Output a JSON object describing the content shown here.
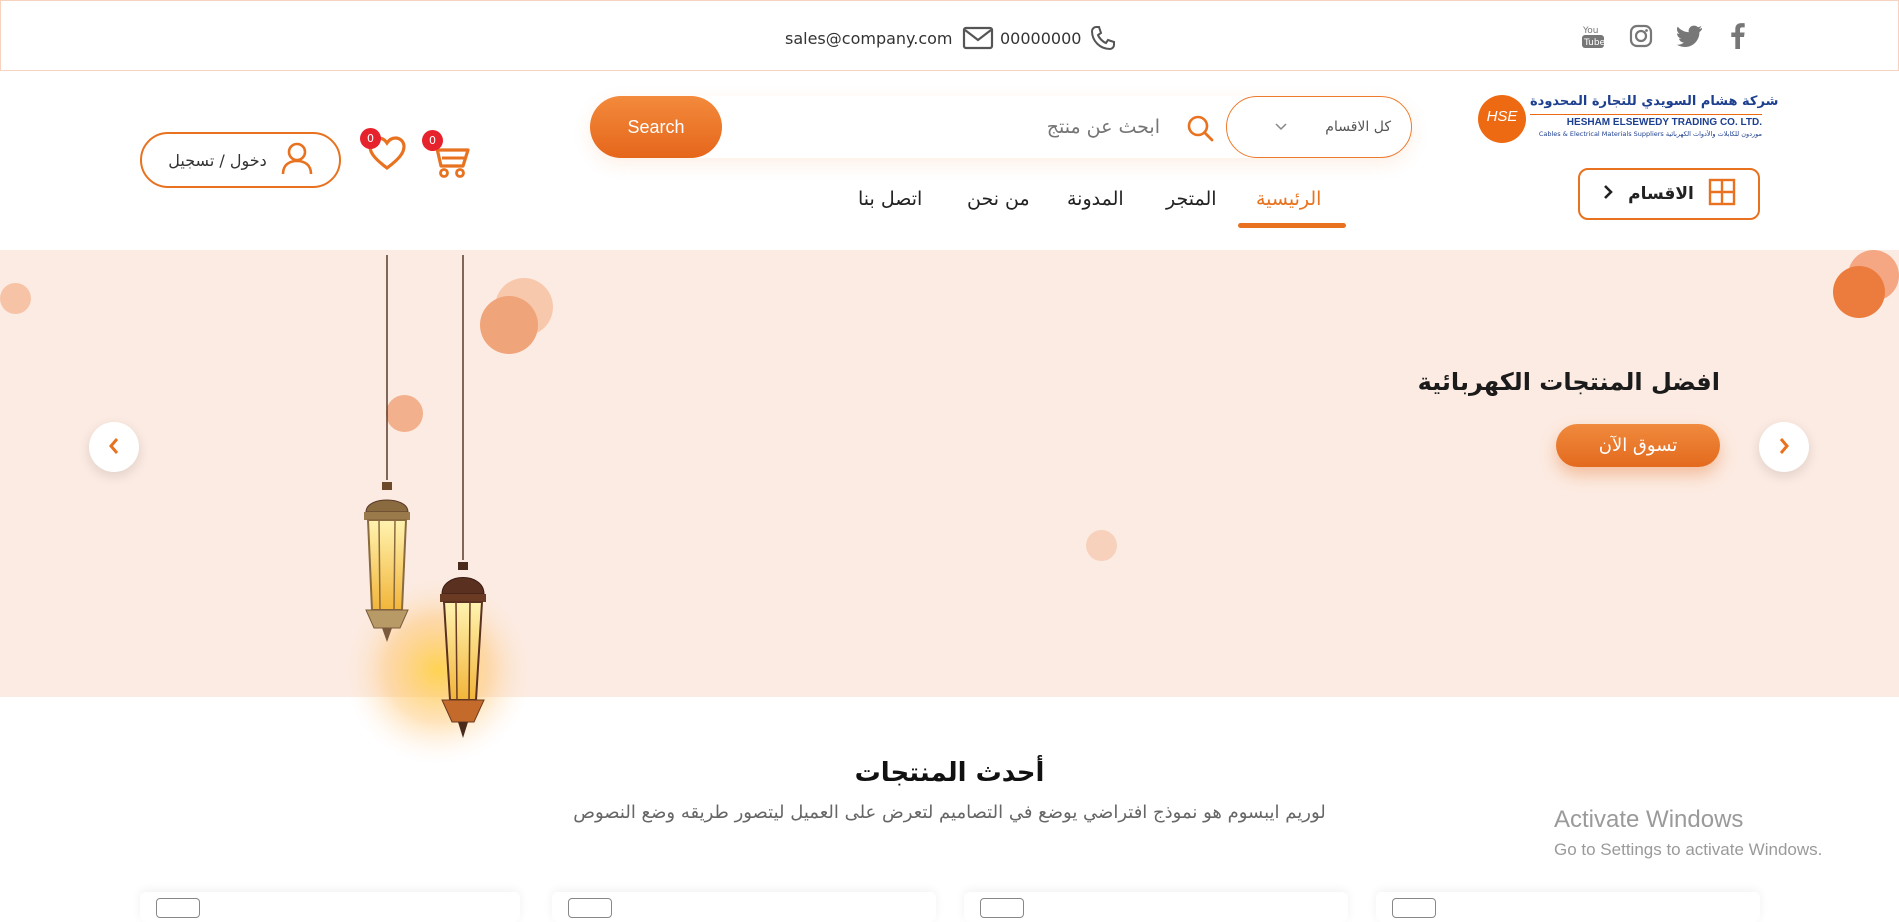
{
  "topbar": {
    "email": "sales@company.com",
    "phone": "00000000",
    "social_icons": [
      "youtube-icon",
      "instagram-icon",
      "twitter-icon",
      "facebook-icon"
    ]
  },
  "header": {
    "logo": {
      "mark": "HSE",
      "line1": "شركة هشام السويدي للتجارة المحدودة",
      "line2": "HESHAM ELSEWEDY TRADING CO. LTD.",
      "line3": "Cables & Electrical Materials Suppliers  موردون للكابلات والأدوات الكهربائية"
    },
    "search": {
      "button_label": "Search",
      "placeholder": "ابحث عن منتج",
      "category_selected": "كل الاقسام"
    },
    "cart_count": "0",
    "wishlist_count": "0",
    "login_label": "دخول / تسجيل",
    "categories_label": "الاقسام"
  },
  "nav": {
    "items": [
      {
        "label": "الرئيسية",
        "active": true
      },
      {
        "label": "المتجر",
        "active": false
      },
      {
        "label": "المدونة",
        "active": false
      },
      {
        "label": "من نحن",
        "active": false
      },
      {
        "label": "اتصل بنا",
        "active": false
      }
    ]
  },
  "hero": {
    "title": "افضل المنتجات الكهربائية",
    "cta_label": "تسوق الآن"
  },
  "latest": {
    "title": "أحدث المنتجات",
    "subtitle": "لوريم ايبسوم هو نموذج افتراضي يوضع في التصاميم لتعرض على العميل ليتصور طريقه وضع النصوص"
  },
  "watermark": {
    "title": "Activate Windows",
    "subtitle": "Go to Settings to activate Windows."
  },
  "colors": {
    "accent": "#e8721f",
    "hero_bg": "#fcebe2",
    "badge": "#e6222d"
  }
}
